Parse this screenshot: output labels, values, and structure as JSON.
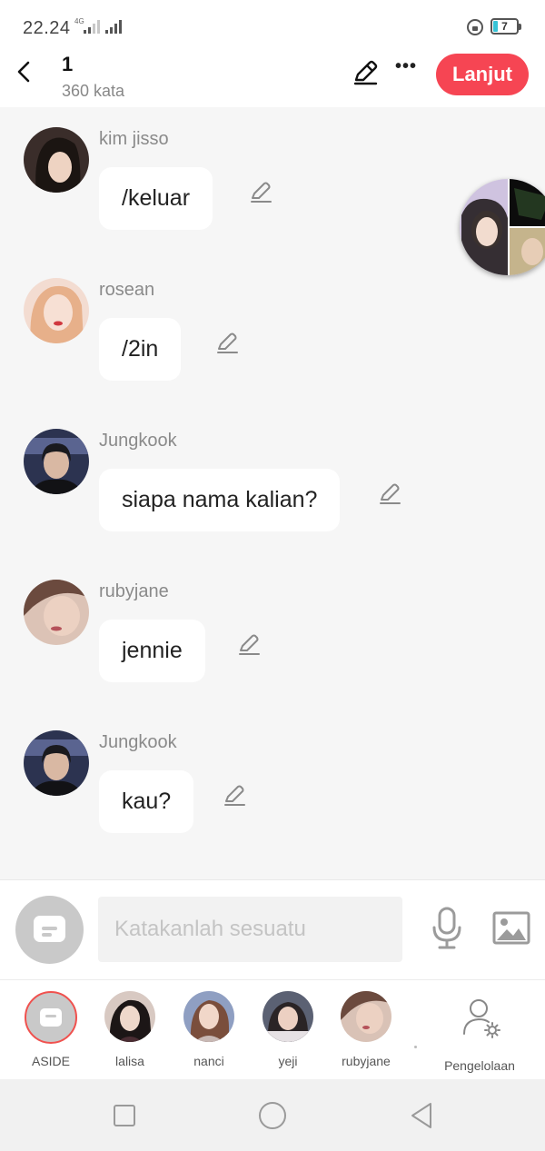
{
  "status_bar": {
    "time": "22.24",
    "network": "4G",
    "battery": "7"
  },
  "header": {
    "title": "1",
    "word_count": "360 kata",
    "next_label": "Lanjut",
    "more_label": "•••"
  },
  "messages": [
    {
      "sender": "kim jisso",
      "text": "/keluar"
    },
    {
      "sender": "rosean",
      "text": "/2in"
    },
    {
      "sender": "Jungkook",
      "text": "siapa nama kalian?"
    },
    {
      "sender": "rubyjane",
      "text": "jennie"
    },
    {
      "sender": "Jungkook",
      "text": "kau?"
    }
  ],
  "composer": {
    "placeholder": "Katakanlah sesuatu"
  },
  "characters": [
    {
      "name": "ASIDE"
    },
    {
      "name": "lalisa"
    },
    {
      "name": "nanci"
    },
    {
      "name": "yeji"
    },
    {
      "name": "rubyjane"
    },
    {
      "name": "Pengelolaan"
    }
  ],
  "colors": {
    "accent": "#f64553",
    "background": "#f6f6f6",
    "sender_text": "#8a8a8a"
  },
  "icons": [
    "back-arrow-icon",
    "pencil-icon",
    "more-icon",
    "microphone-icon",
    "image-icon",
    "user-settings-icon"
  ]
}
